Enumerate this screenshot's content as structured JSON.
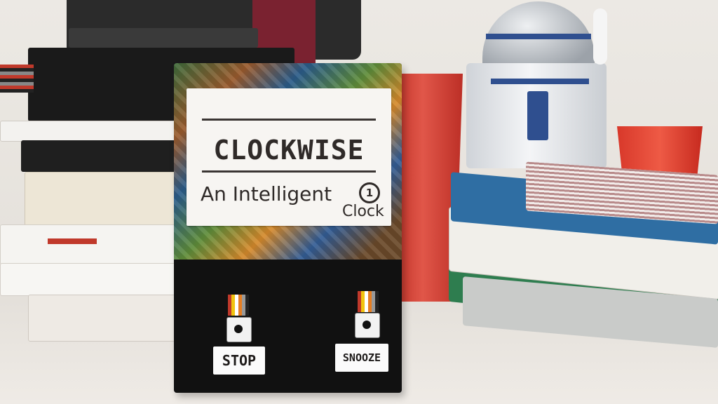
{
  "label": {
    "title": "CLOCKWISE",
    "subtitle": "An Intelligent",
    "subtitle_word2": "Clock",
    "icon_glyph": "1"
  },
  "buttons": {
    "stop_label": "STOP",
    "snooze_label": "SNOOZE"
  },
  "colors": {
    "cup": "#d8382a",
    "box": "#111111",
    "robot_blue": "#2f4f8f"
  }
}
